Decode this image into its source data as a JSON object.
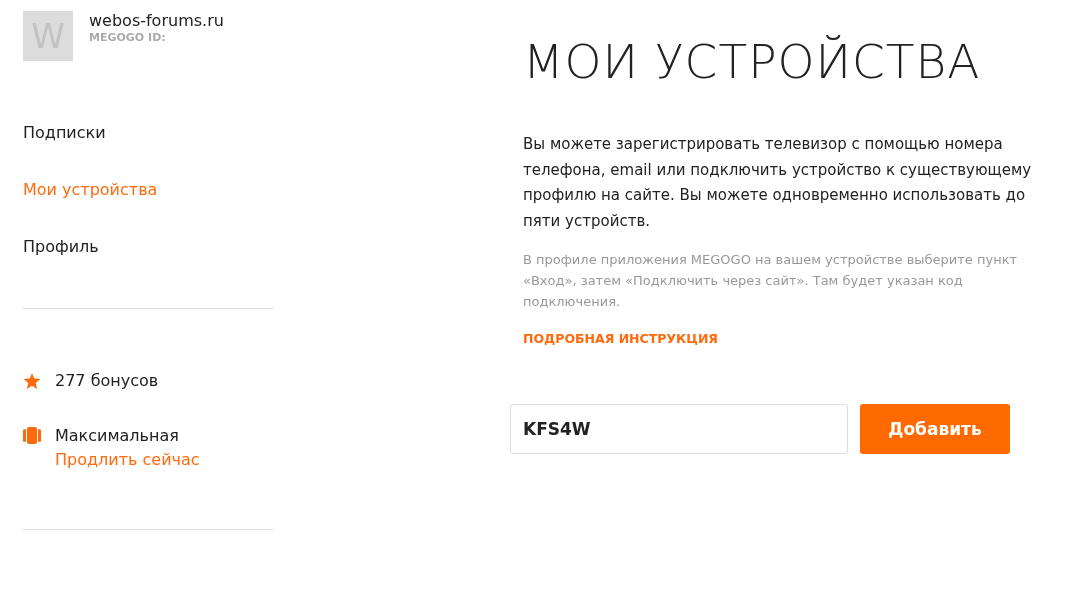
{
  "user": {
    "avatar_letter": "W",
    "name": "webos-forums.ru",
    "id_label": "MEGOGO ID:"
  },
  "menu": [
    {
      "label": "Подписки",
      "selected": false
    },
    {
      "label": "Мои устройства",
      "selected": true
    },
    {
      "label": "Профиль",
      "selected": false
    }
  ],
  "bonuses": {
    "text": "277 бонусов"
  },
  "subscription": {
    "name": "Максимальная",
    "renew_link": "Продлить сейчас"
  },
  "page": {
    "title": "МОИ УСТРОЙСТВА",
    "description": "Вы можете зарегистрировать телевизор с помощью номера телефона, email или подключить устройство к существующему профилю на сайте. Вы можете одновременно использовать до пяти устройств.",
    "hint": "В профиле приложения MEGOGO на вашем устройстве выберите пункт «Вход», затем «Подключить через сайт». Там будет указан код подключения.",
    "instructions_link": "ПОДРОБНАЯ ИНСТРУКЦИЯ",
    "code_field": {
      "value": "KFS4W"
    },
    "add_button": "Добавить"
  }
}
